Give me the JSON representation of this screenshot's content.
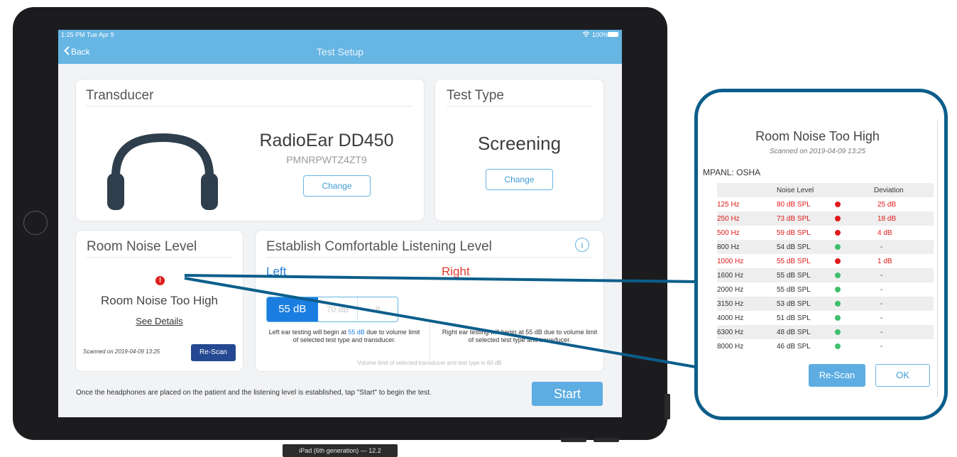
{
  "status": {
    "time": "1:25 PM  Tue Apr 9",
    "battery": "100%"
  },
  "nav": {
    "back": "Back",
    "title": "Test Setup"
  },
  "transducer": {
    "title": "Transducer",
    "name": "RadioEar DD450",
    "serial": "PMNRPWTZ4ZT9",
    "change": "Change"
  },
  "test_type": {
    "title": "Test Type",
    "value": "Screening",
    "change": "Change"
  },
  "room_noise": {
    "title": "Room Noise Level",
    "status": "Room Noise Too High",
    "details": "See Details",
    "scanned": "Scanned on 2019-04-09 13:25",
    "rescan": "Re-Scan"
  },
  "comfort": {
    "title": "Establish Comfortable Listening Level",
    "info": "i",
    "left_label": "Left",
    "right_label": "Right",
    "levels": [
      "55 dB",
      "70 dB",
      "8"
    ],
    "left_note_pre": "Left ear testing will begin at ",
    "left_note_val": "55 dB",
    "left_note_post": " due to volume limit of selected test type and transducer.",
    "right_note": "Right ear testing will begin at 55 dB due to volume limit of selected test type and transducer.",
    "limit_note": "Volume limit of selected transducer and test type is 60 dB"
  },
  "footer": {
    "instruction": "Once the headphones are placed on the patient and the listening level is established, tap \"Start\" to begin the test.",
    "start": "Start"
  },
  "device_label": "iPad (6th generation) — 12.2",
  "popup": {
    "title": "Room Noise Too High",
    "scanned": "Scanned on 2019-04-09 13:25",
    "standard": "MPANL: OSHA",
    "headers": [
      "Noise Level",
      "Deviation"
    ],
    "rows": [
      {
        "freq": "125 Hz",
        "level": "80 dB SPL",
        "dev": "25 dB",
        "fail": true
      },
      {
        "freq": "250 Hz",
        "level": "73 dB SPL",
        "dev": "18 dB",
        "fail": true
      },
      {
        "freq": "500 Hz",
        "level": "59 dB SPL",
        "dev": "4 dB",
        "fail": true
      },
      {
        "freq": "800 Hz",
        "level": "54 dB SPL",
        "dev": "-",
        "fail": false
      },
      {
        "freq": "1000 Hz",
        "level": "55 dB SPL",
        "dev": "1 dB",
        "fail": true
      },
      {
        "freq": "1600 Hz",
        "level": "55 dB SPL",
        "dev": "-",
        "fail": false
      },
      {
        "freq": "2000 Hz",
        "level": "55 dB SPL",
        "dev": "-",
        "fail": false
      },
      {
        "freq": "3150 Hz",
        "level": "53 dB SPL",
        "dev": "-",
        "fail": false
      },
      {
        "freq": "4000 Hz",
        "level": "51 dB SPL",
        "dev": "-",
        "fail": false
      },
      {
        "freq": "6300 Hz",
        "level": "48 dB SPL",
        "dev": "-",
        "fail": false
      },
      {
        "freq": "8000 Hz",
        "level": "46 dB SPL",
        "dev": "-",
        "fail": false
      }
    ],
    "rescan": "Re-Scan",
    "ok": "OK"
  },
  "colors": {
    "accent": "#66b5e3",
    "navy": "#244891",
    "alert": "#e01b1b",
    "ok": "#3fbf6a",
    "callout": "#0b5e8b"
  }
}
